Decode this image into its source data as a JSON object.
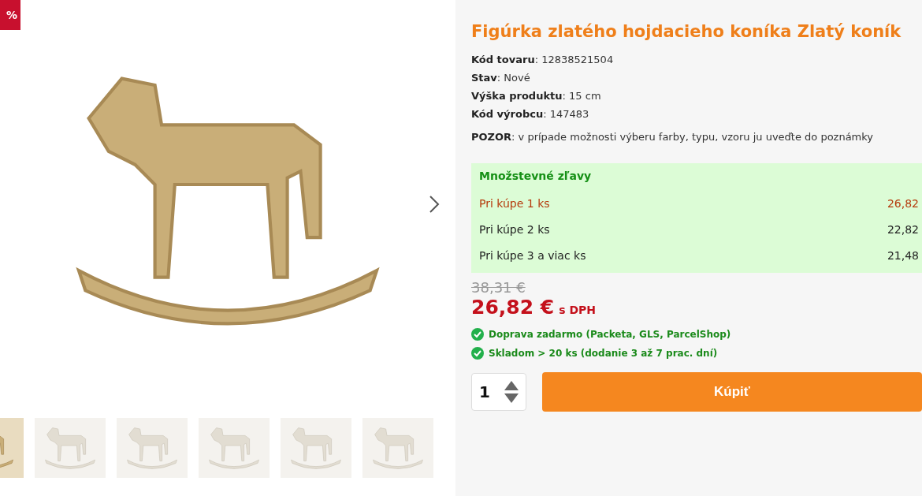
{
  "badge": "%",
  "gallery": {
    "thumbnails": [
      {
        "selected": true
      },
      {
        "selected": false
      },
      {
        "selected": false
      },
      {
        "selected": false
      },
      {
        "selected": false
      },
      {
        "selected": false
      }
    ]
  },
  "product": {
    "title": "Figúrka zlatého hojdacieho koníka Zlatý koník",
    "attributes": [
      "**Kód tovaru**: 12838521504",
      "**Stav**: Nové",
      "**Výška produktu**: 15 cm",
      "**Kód výrobcu**: 147483"
    ],
    "note": "**POZOR**: v prípade možnosti výberu farby, typu, vzoru ju uveďte do poznámky",
    "discounts": {
      "title": "Množstevné zľavy",
      "rows": [
        {
          "label": "Pri kúpe 1 ks",
          "price": "26,82",
          "selected": true
        },
        {
          "label": "Pri kúpe 2 ks",
          "price": "22,82",
          "selected": false
        },
        {
          "label": "Pri kúpe 3 a viac ks",
          "price": "21,48",
          "selected": false
        }
      ]
    },
    "old_price": "38,31 €",
    "price": "26,82 €",
    "price_suffix": "s DPH",
    "benefits": [
      "Doprava zadarmo (Packeta, GLS, ParcelShop)",
      "Skladom > 20 ks (dodanie 3 až 7 prac. dní)"
    ],
    "quantity": "1",
    "buy_button": "Kúpiť"
  }
}
